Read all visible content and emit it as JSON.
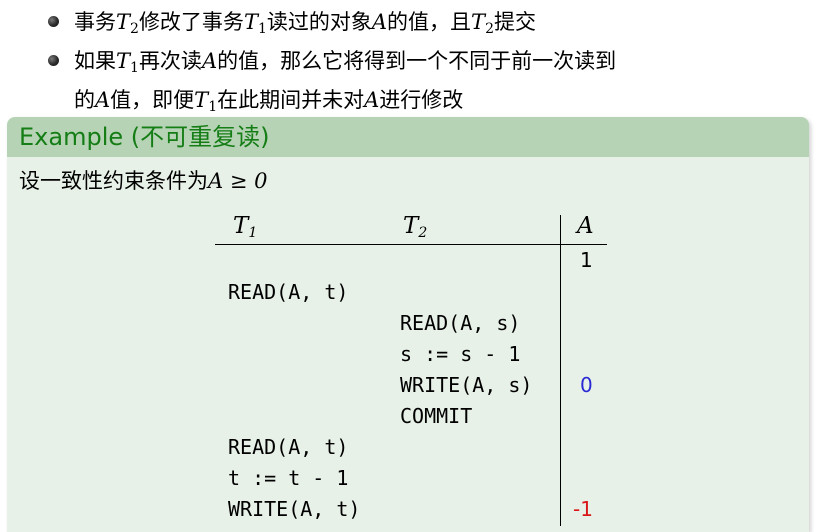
{
  "bullets": [
    {
      "parts": [
        "事务",
        "T",
        "2",
        "修改了事务",
        "T",
        "1",
        "读过的对象",
        "A",
        "的值，且",
        "T",
        "2",
        "提交"
      ]
    },
    {
      "line1_parts": [
        "如果",
        "T",
        "1",
        "再次读",
        "A",
        "的值，那么它将得到一个不同于前一次读到"
      ],
      "line2_parts": [
        "的",
        "A",
        "值，即便",
        "T",
        "1",
        "在此期间并未对",
        "A",
        "进行修改"
      ]
    }
  ],
  "example": {
    "title": "Example (不可重复读)",
    "constraint_text": "设一致性约束条件为",
    "constraint_math": "A ≥ 0"
  },
  "table": {
    "headers": {
      "t1": "T",
      "t1_sub": "1",
      "t2": "T",
      "t2_sub": "2",
      "a": "A"
    },
    "rows": [
      {
        "t1": "",
        "t2": "",
        "a": "1"
      },
      {
        "t1": "READ(A, t)",
        "t2": "",
        "a": ""
      },
      {
        "t1": "",
        "t2": "READ(A, s)",
        "a": ""
      },
      {
        "t1": "",
        "t2": "s := s - 1",
        "a": ""
      },
      {
        "t1": "",
        "t2": "WRITE(A, s)",
        "a": "0"
      },
      {
        "t1": "",
        "t2": "COMMIT",
        "a": ""
      },
      {
        "t1": "READ(A, t)",
        "t2": "",
        "a": ""
      },
      {
        "t1": "t := t - 1",
        "t2": "",
        "a": ""
      },
      {
        "t1": "WRITE(A, t)",
        "t2": "",
        "a": "-1"
      }
    ]
  },
  "colors": {
    "block_title_bg": "#b6d3b6",
    "block_body_bg": "#e8f1e8",
    "block_title_text": "#157d15",
    "value_zero": "#2a2ad4",
    "value_negative": "#d81818"
  }
}
